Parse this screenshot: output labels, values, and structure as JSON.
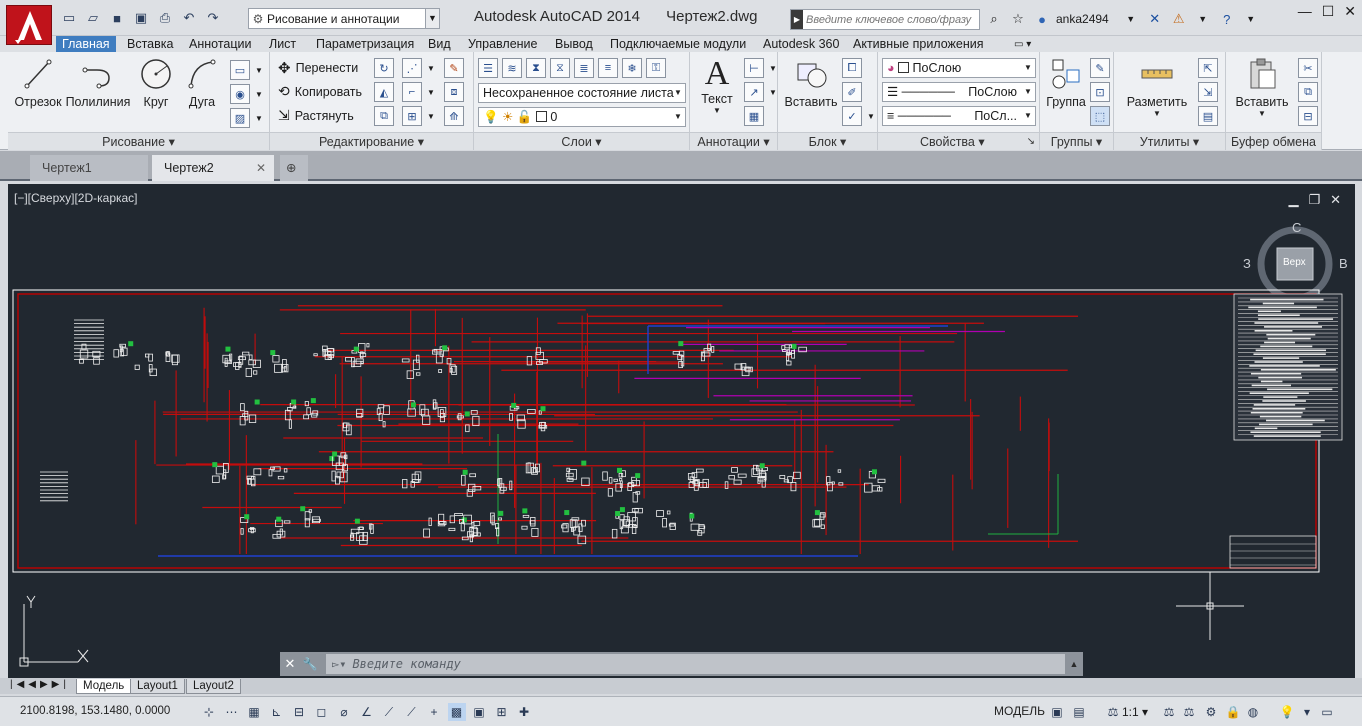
{
  "app": {
    "title": "Autodesk AutoCAD 2014",
    "document": "Чертеж2.dwg"
  },
  "workspace": {
    "value": "Рисование и аннотации"
  },
  "search": {
    "placeholder": "Введите ключевое слово/фразу"
  },
  "user": {
    "name": "anka2494"
  },
  "menu_tabs": [
    "Главная",
    "Вставка",
    "Аннотации",
    "Лист",
    "Параметризация",
    "Вид",
    "Управление",
    "Вывод",
    "Подключаемые модули",
    "Autodesk 360",
    "Активные приложения"
  ],
  "ribbon": {
    "draw": {
      "title": "Рисование",
      "line": "Отрезок",
      "polyline": "Полилиния",
      "circle": "Круг",
      "arc": "Дуга"
    },
    "modify": {
      "title": "Редактирование",
      "move": "Перенести",
      "copy": "Копировать",
      "stretch": "Растянуть"
    },
    "layers": {
      "title": "Слои",
      "state": "Несохраненное состояние листа",
      "layer": "0"
    },
    "annotation": {
      "title": "Аннотации",
      "text": "Текст"
    },
    "block": {
      "title": "Блок",
      "insert": "Вставить"
    },
    "properties": {
      "title": "Свойства",
      "color": "ПоСлою",
      "linetype": "ПоСлою",
      "lineweight": "ПоСл..."
    },
    "groups": {
      "title": "Группы",
      "group": "Группа"
    },
    "utilities": {
      "title": "Утилиты",
      "measure": "Разметить"
    },
    "clipboard": {
      "title": "Буфер обмена",
      "paste": "Вставить"
    }
  },
  "doc_tabs": [
    "Чертеж1",
    "Чертеж2"
  ],
  "viewport": {
    "label": "[−][Сверху][2D-каркас]",
    "viewcube": {
      "top": "Верх",
      "north": "С",
      "west": "З",
      "east": "В"
    }
  },
  "command": {
    "placeholder": "Введите команду"
  },
  "layout_tabs": [
    "Модель",
    "Layout1",
    "Layout2"
  ],
  "status": {
    "coords": "2100.8198, 153.1480, 0.0000",
    "space": "МОДЕЛЬ",
    "scale": "1:1"
  },
  "colors": {
    "accent": "#3f7dc0",
    "canvas": "#212830",
    "frame": "#c00000"
  }
}
